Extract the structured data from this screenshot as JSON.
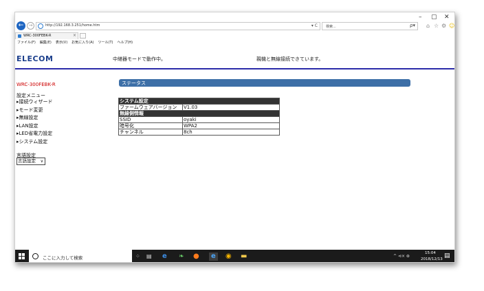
{
  "window": {
    "min": "–",
    "max": "▢",
    "close": "✕"
  },
  "browser": {
    "url": "http://192.168.3.251/home.htm",
    "url_controls": "▾ C",
    "search_placeholder": "検索...",
    "search_icon": "ρ▾",
    "tab_title": "WRC-300FEBK-R",
    "tab_close": "×",
    "menu": [
      "ファイル(F)",
      "編集(E)",
      "表示(V)",
      "お気に入り(A)",
      "ツール(T)",
      "ヘルプ(H)"
    ]
  },
  "page": {
    "logo": "ELECOM",
    "mode_message": "中継器モードで動作中。",
    "connection_message": "親機と無線接続できています。",
    "model": "WRC-300FEBK-R",
    "menu_title": "設定メニュー",
    "menu": [
      "▸接続ウィザード",
      "▸モード変更",
      "▸無線設定",
      "▸LAN設定",
      "▸LED省電力設定",
      "▸システム設定"
    ],
    "language_title": "言語設定",
    "language_select": "言語設定",
    "section_title": "ステータス",
    "table": {
      "system_header": "システム設定",
      "firmware_label": "ファームウェアバージョン",
      "firmware_value": "V1.03",
      "wireless_header": "無線側情報",
      "ssid_label": "SSID",
      "ssid_value": "oyaki",
      "encryption_label": "暗号化",
      "encryption_value": "WPA2",
      "channel_label": "チャンネル",
      "channel_value": "8ch"
    }
  },
  "taskbar": {
    "search_text": "ここに入力して検索",
    "tray": "^ ⊲× ⊛",
    "time": "15:04",
    "date": "2018/12/13",
    "notification_count": "2"
  }
}
